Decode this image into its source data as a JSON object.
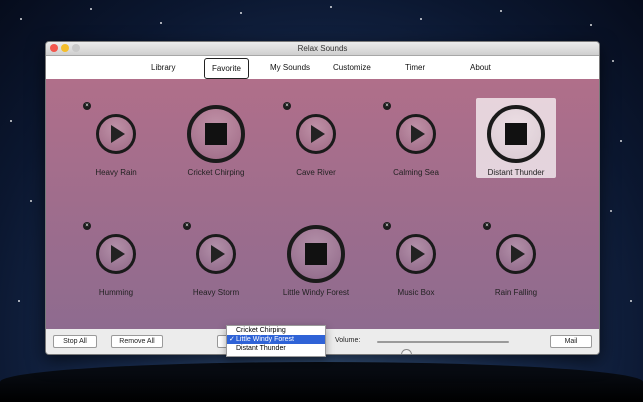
{
  "window": {
    "title": "Relax Sounds"
  },
  "tabs": [
    "Library",
    "Favorite",
    "My Sounds",
    "Customize",
    "Timer",
    "About"
  ],
  "active_tab": "Favorite",
  "sounds": [
    {
      "label": "Heavy Rain",
      "state": "play"
    },
    {
      "label": "Cricket Chirping",
      "state": "stop"
    },
    {
      "label": "Cave River",
      "state": "play"
    },
    {
      "label": "Calming Sea",
      "state": "play"
    },
    {
      "label": "Distant Thunder",
      "state": "stop"
    },
    {
      "label": "Humming",
      "state": "play"
    },
    {
      "label": "Heavy Storm",
      "state": "play"
    },
    {
      "label": "Little Windy Forest",
      "state": "stop"
    },
    {
      "label": "Music Box",
      "state": "play"
    },
    {
      "label": "Rain Falling",
      "state": "play"
    }
  ],
  "footer": {
    "stop_all": "Stop All",
    "remove_all": "Remove All",
    "volume_label": "Volume:",
    "volume_level": 0.22,
    "mail": "Mail"
  },
  "playing_menu": {
    "items": [
      "Cricket Chirping",
      "Little Windy Forest",
      "Distant Thunder"
    ],
    "selected": "Little Windy Forest",
    "check": "✓"
  },
  "colors": {
    "grid_top": "#b06f8a",
    "grid_bottom": "#8e6b8f",
    "menu_highlight": "#2f63d7"
  }
}
